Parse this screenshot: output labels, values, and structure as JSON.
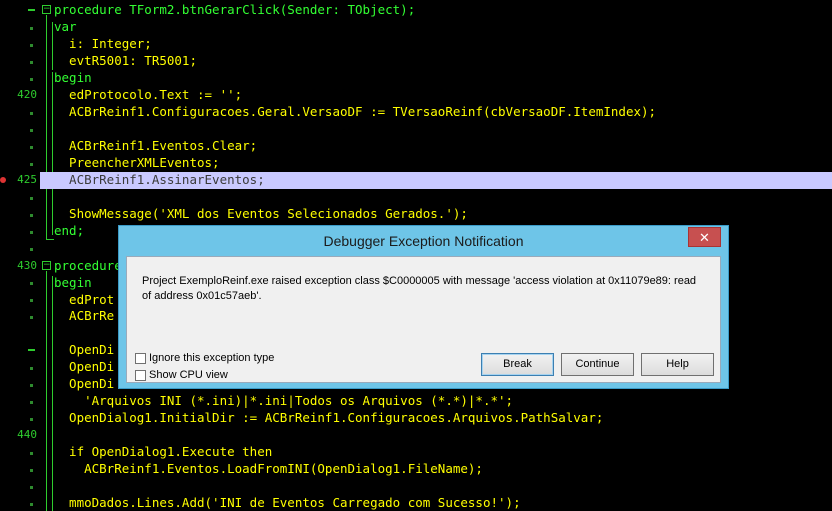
{
  "editor": {
    "line_numbers": [
      "420",
      "425",
      "430",
      "440"
    ],
    "lines": [
      {
        "text": "procedure TForm2.btnGerarClick(Sender: TObject);"
      },
      {
        "text": "var"
      },
      {
        "text": "  i: Integer;"
      },
      {
        "text": "  evtR5001: TR5001;"
      },
      {
        "text": "begin"
      },
      {
        "text": "  edProtocolo.Text := '';"
      },
      {
        "text": "  ACBrReinf1.Configuracoes.Geral.VersaoDF := TVersaoReinf(cbVersaoDF.ItemIndex);"
      },
      {
        "text": ""
      },
      {
        "text": "  ACBrReinf1.Eventos.Clear;"
      },
      {
        "text": "  PreencherXMLEventos;"
      },
      {
        "text": "  ACBrReinf1.AssinarEventos;"
      },
      {
        "text": ""
      },
      {
        "text": "  ShowMessage('XML dos Eventos Selecionados Gerados.');"
      },
      {
        "text": "end;"
      },
      {
        "text": ""
      },
      {
        "text": "procedure"
      },
      {
        "text": "begin"
      },
      {
        "text": "  edProt"
      },
      {
        "text": "  ACBrRe"
      },
      {
        "text": ""
      },
      {
        "text": "  OpenDi"
      },
      {
        "text": "  OpenDi"
      },
      {
        "text": "  OpenDi"
      },
      {
        "text": "    'Arquivos INI (*.ini)|*.ini|Todos os Arquivos (*.*)|*.*';"
      },
      {
        "text": "  OpenDialog1.InitialDir := ACBrReinf1.Configuracoes.Arquivos.PathSalvar;"
      },
      {
        "text": ""
      },
      {
        "text": "  if OpenDialog1.Execute then"
      },
      {
        "text": "    ACBrReinf1.Eventos.LoadFromINI(OpenDialog1.FileName);"
      },
      {
        "text": ""
      },
      {
        "text": "  mmoDados.Lines.Add('INI de Eventos Carregado com Sucesso!');"
      }
    ]
  },
  "dialog": {
    "title": "Debugger Exception Notification",
    "close_glyph": "✕",
    "message": "Project ExemploReinf.exe raised exception class $C0000005 with message 'access violation at 0x11079e89: read of address 0x01c57aeb'.",
    "ignore_label": "Ignore this exception type",
    "cpu_label": "Show CPU view",
    "break_label": "Break",
    "continue_label": "Continue",
    "help_label": "Help"
  }
}
